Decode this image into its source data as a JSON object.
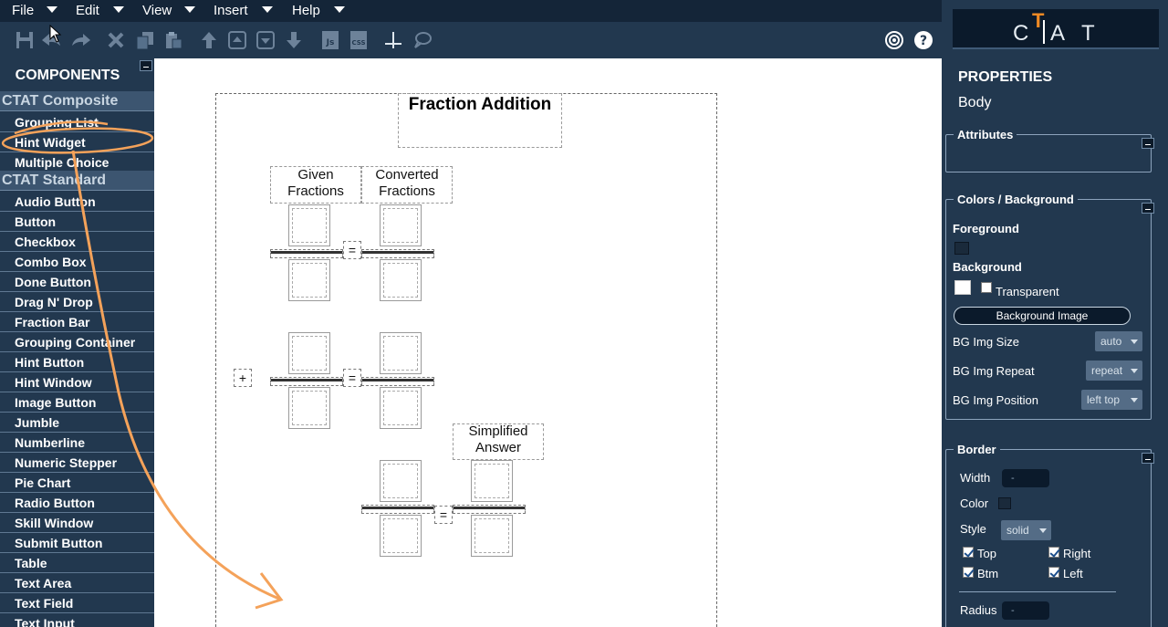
{
  "menu": [
    {
      "label": "File"
    },
    {
      "label": "Edit"
    },
    {
      "label": "View"
    },
    {
      "label": "Insert"
    },
    {
      "label": "Help"
    }
  ],
  "toolbar": {
    "icons": [
      "save-icon",
      "undo-icon",
      "redo-icon",
      "delete-icon",
      "copy-icon",
      "paste-icon",
      "move-up-icon",
      "move-top-icon",
      "move-bottom-icon",
      "move-down-icon",
      "js-icon",
      "css-icon",
      "crosshair-icon",
      "comment-icon",
      "target-icon",
      "help-icon"
    ],
    "js_label": "Js",
    "css_label": "CSS",
    "help_label": "?"
  },
  "logo": {
    "l1": "C",
    "l2": "T",
    "l3": "A",
    "l4": "T"
  },
  "components": {
    "title": "COMPONENTS",
    "categories": [
      {
        "name": "CTAT Composite",
        "items": [
          "Grouping List",
          "Hint Widget",
          "Multiple Choice"
        ]
      },
      {
        "name": "CTAT Standard",
        "items": [
          "Audio Button",
          "Button",
          "Checkbox",
          "Combo Box",
          "Done Button",
          "Drag N' Drop",
          "Fraction Bar",
          "Grouping Container",
          "Hint Button",
          "Hint Window",
          "Image Button",
          "Jumble",
          "Numberline",
          "Numeric Stepper",
          "Pie Chart",
          "Radio Button",
          "Skill Window",
          "Submit Button",
          "Table",
          "Text Area",
          "Text Field",
          "Text Input"
        ]
      }
    ]
  },
  "canvas": {
    "title": "Fraction Addition",
    "given_label_1": "Given",
    "given_label_2": "Fractions",
    "converted_label_1": "Converted",
    "converted_label_2": "Fractions",
    "simplified_label_1": "Simplified",
    "simplified_label_2": "Answer",
    "equals": "=",
    "plus": "+"
  },
  "properties": {
    "title": "PROPERTIES",
    "target": "Body",
    "attributes_legend": "Attributes",
    "colors_legend": "Colors / Background",
    "foreground_label": "Foreground",
    "background_label": "Background",
    "transparent_label": "Transparent",
    "bg_image_button": "Background Image",
    "bg_size_label": "BG Img Size",
    "bg_size_value": "auto",
    "bg_repeat_label": "BG Img Repeat",
    "bg_repeat_value": "repeat",
    "bg_position_label": "BG Img Position",
    "bg_position_value": "left top",
    "border_legend": "Border",
    "width_label": "Width",
    "width_value": "-",
    "color_label": "Color",
    "style_label": "Style",
    "style_value": "solid",
    "top_label": "Top",
    "right_label": "Right",
    "btm_label": "Btm",
    "left_label": "Left",
    "radius_label": "Radius",
    "radius_value": "-"
  },
  "colors": {
    "panel_bg": "#22384f",
    "menubar_bg": "#142538",
    "annotation": "#f4a25a",
    "logo_accent": "#f08a24"
  }
}
